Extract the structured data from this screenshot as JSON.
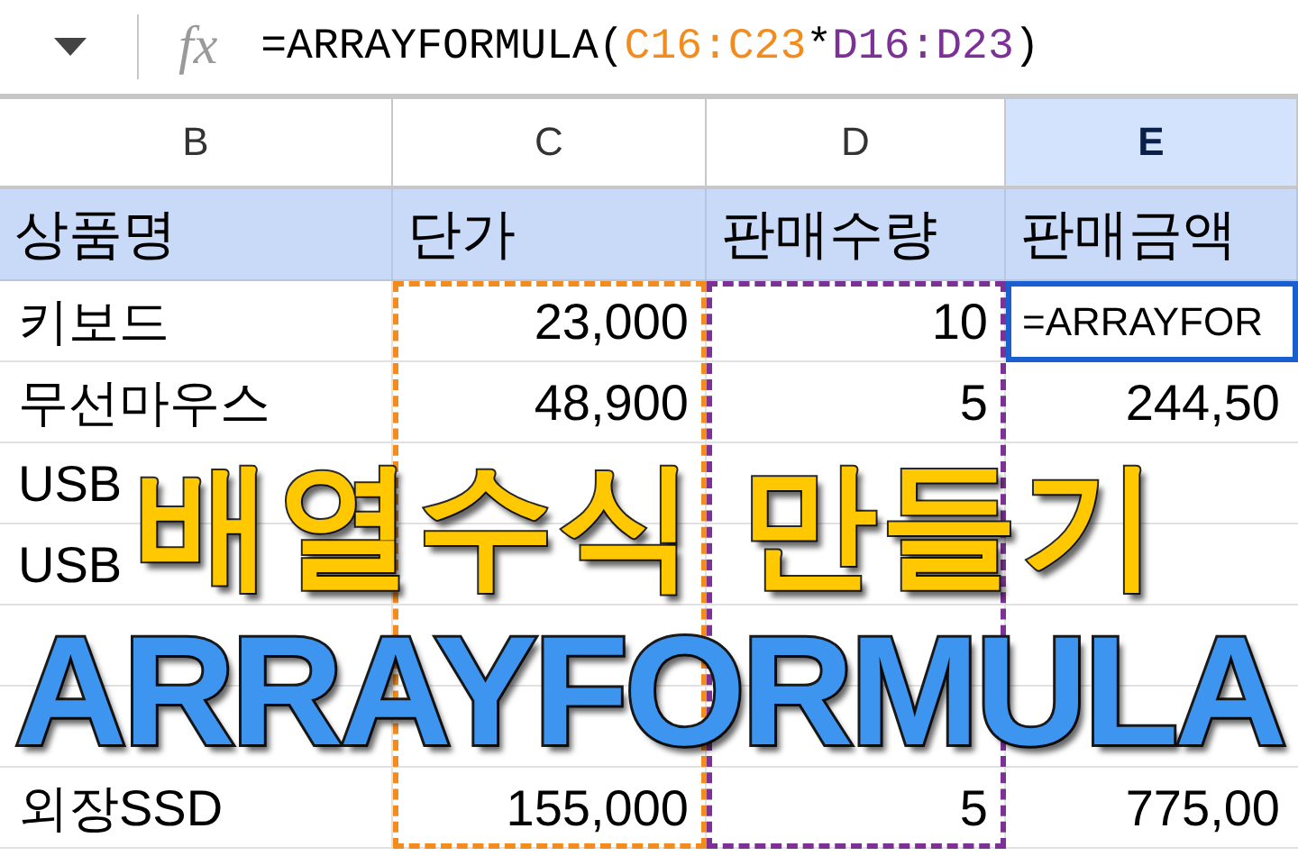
{
  "formula_bar": {
    "fx": "fx",
    "segments": [
      {
        "text": "=ARRAYFORMULA(",
        "color": "#000000"
      },
      {
        "text": "C16:C23",
        "color": "#f28c1e"
      },
      {
        "text": "*",
        "color": "#000000"
      },
      {
        "text": "D16:D23",
        "color": "#7b3294"
      },
      {
        "text": ")",
        "color": "#000000"
      }
    ]
  },
  "columns": [
    {
      "label": "B",
      "selected": false
    },
    {
      "label": "C",
      "selected": false,
      "color": "#f28c1e"
    },
    {
      "label": "D",
      "selected": false,
      "color": "#7b3294"
    },
    {
      "label": "E",
      "selected": true
    }
  ],
  "header_row": [
    "상품명",
    "단가",
    "판매수량",
    "판매금액"
  ],
  "rows": [
    {
      "cells": [
        "키보드",
        "23,000",
        "10",
        "=ARRAYFOR"
      ],
      "active": true
    },
    {
      "cells": [
        "무선마우스",
        "48,900",
        "5",
        "244,50"
      ],
      "active": false
    },
    {
      "cells": [
        "USB",
        null,
        null,
        null
      ],
      "active": false
    },
    {
      "cells": [
        "USB",
        null,
        null,
        null
      ],
      "active": false
    },
    {
      "cells": [
        null,
        null,
        null,
        null
      ],
      "active": false
    },
    {
      "cells": [
        null,
        null,
        null,
        null
      ],
      "active": false
    },
    {
      "cells": [
        "외장SSD",
        "155,000",
        "5",
        "775,00"
      ],
      "active": false
    }
  ],
  "title": {
    "line1": "배열수식 만들기",
    "line2": "ARRAYFORMULA"
  }
}
